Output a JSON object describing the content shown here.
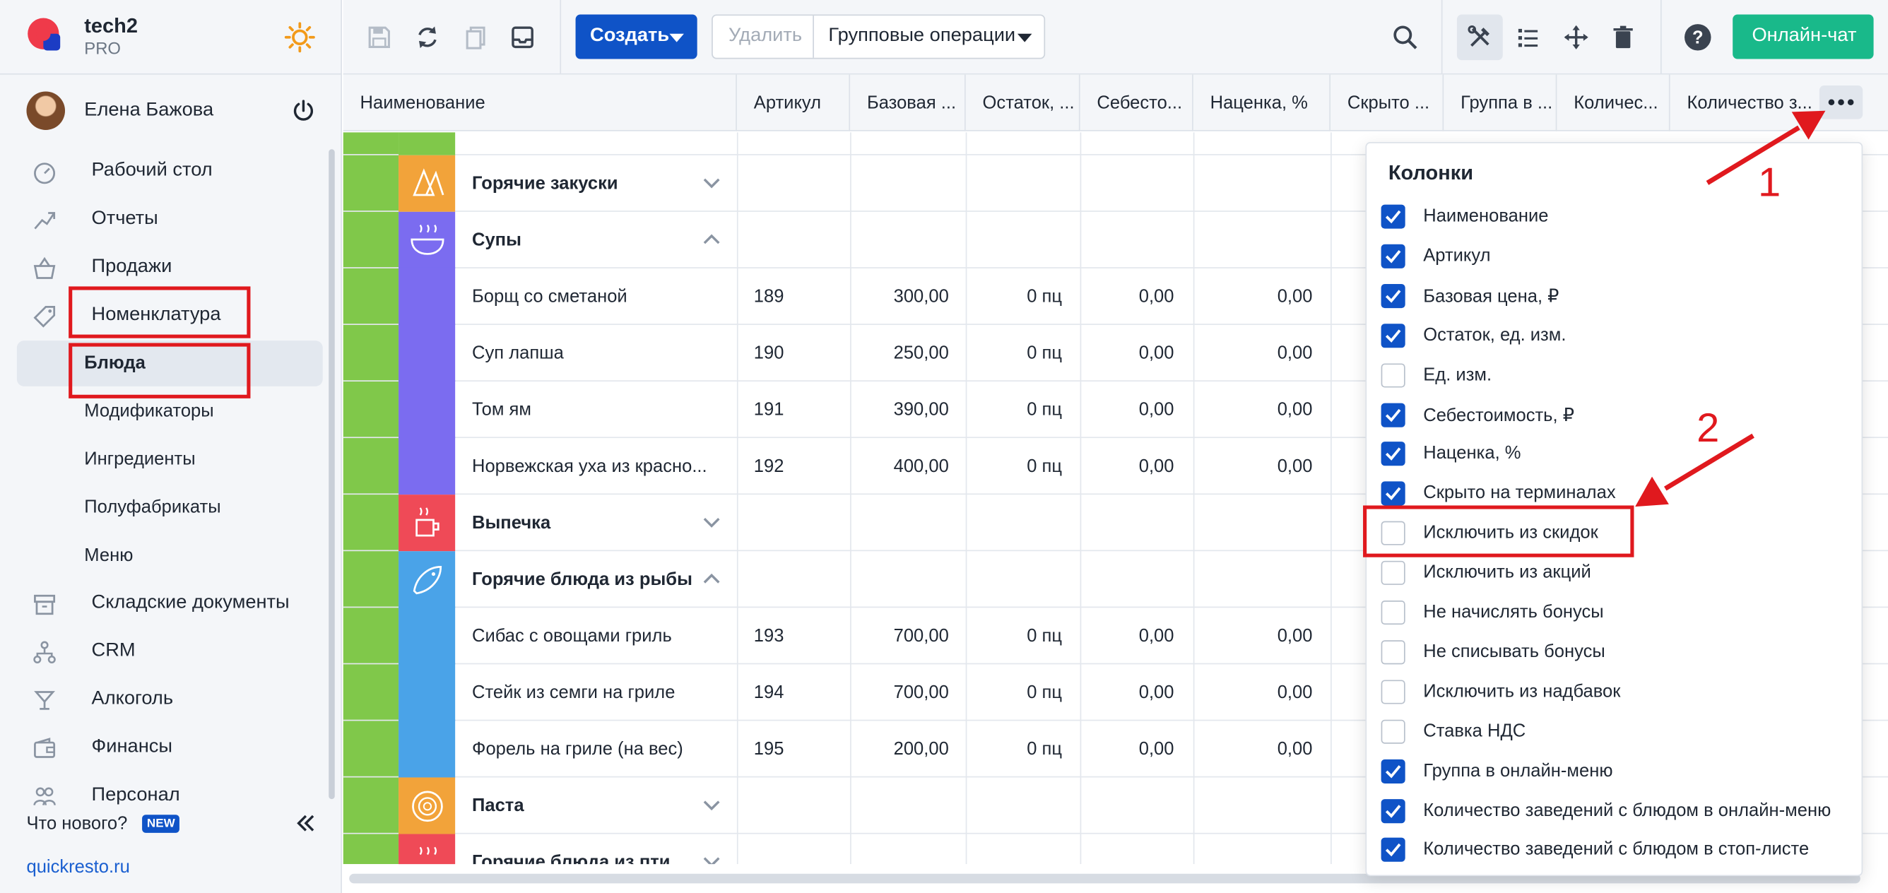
{
  "brand": {
    "name": "tech2",
    "plan": "PRO"
  },
  "user": {
    "name": "Елена Бажова"
  },
  "nav": [
    {
      "label": "Рабочий стол",
      "icon": "dashboard-icon"
    },
    {
      "label": "Отчеты",
      "icon": "chart-icon"
    },
    {
      "label": "Продажи",
      "icon": "basket-icon"
    },
    {
      "label": "Номенклатура",
      "icon": "tag-icon"
    },
    {
      "label": "Блюда",
      "sub": true
    },
    {
      "label": "Модификаторы",
      "sub": true
    },
    {
      "label": "Ингредиенты",
      "sub": true
    },
    {
      "label": "Полуфабрикаты",
      "sub": true
    },
    {
      "label": "Меню",
      "sub": true
    },
    {
      "label": "Складские документы",
      "icon": "warehouse-icon"
    },
    {
      "label": "CRM",
      "icon": "org-icon"
    },
    {
      "label": "Алкоголь",
      "icon": "glass-icon"
    },
    {
      "label": "Финансы",
      "icon": "wallet-icon"
    },
    {
      "label": "Персонал",
      "icon": "people-icon"
    }
  ],
  "sidebar_footer": {
    "whats_new": "Что нового?",
    "badge": "NEW",
    "site": "quickresto.ru"
  },
  "toolbar": {
    "create": "Создать",
    "delete": "Удалить",
    "group_ops": "Групповые операции",
    "chat": "Онлайн-чат"
  },
  "columns": [
    "Наименование",
    "Артикул",
    "Базовая ...",
    "Остаток, ...",
    "Себесто...",
    "Наценка, %",
    "Скрыто ...",
    "Группа в ...",
    "Количес...",
    "Количество з..."
  ],
  "rows": [
    {
      "type": "group",
      "name": "Горячие закуски",
      "color": "#f2a33a",
      "icon": "nachos-icon",
      "expanded": false
    },
    {
      "type": "group",
      "name": "Супы",
      "color": "#7b6cf0",
      "icon": "soup-icon",
      "expanded": true
    },
    {
      "type": "item",
      "name": "Борщ со сметаной",
      "sku": "189",
      "price": "300,00",
      "stock": "0 пц",
      "cost": "0,00",
      "markup": "0,00"
    },
    {
      "type": "item",
      "name": "Суп лапша",
      "sku": "190",
      "price": "250,00",
      "stock": "0 пц",
      "cost": "0,00",
      "markup": "0,00"
    },
    {
      "type": "item",
      "name": "Том ям",
      "sku": "191",
      "price": "390,00",
      "stock": "0 пц",
      "cost": "0,00",
      "markup": "0,00"
    },
    {
      "type": "item",
      "name": "Норвежская уха из красно...",
      "sku": "192",
      "price": "400,00",
      "stock": "0 пц",
      "cost": "0,00",
      "markup": "0,00"
    },
    {
      "type": "group",
      "name": "Выпечка",
      "color": "#ef4a57",
      "icon": "coffee-icon",
      "expanded": false
    },
    {
      "type": "group",
      "name": "Горячие блюда из рыбы",
      "color": "#4aa3e8",
      "icon": "fish-icon",
      "expanded": true
    },
    {
      "type": "item",
      "name": "Сибас с овощами гриль",
      "sku": "193",
      "price": "700,00",
      "stock": "0 пц",
      "cost": "0,00",
      "markup": "0,00"
    },
    {
      "type": "item",
      "name": "Стейк из семги на гриле",
      "sku": "194",
      "price": "700,00",
      "stock": "0 пц",
      "cost": "0,00",
      "markup": "0,00"
    },
    {
      "type": "item",
      "name": "Форель на гриле (на вес)",
      "sku": "195",
      "price": "200,00",
      "stock": "0 пц",
      "cost": "0,00",
      "markup": "0,00"
    },
    {
      "type": "group",
      "name": "Паста",
      "color": "#f2a33a",
      "icon": "pasta-icon",
      "expanded": false
    },
    {
      "type": "group",
      "name": "Горячие блюда из пти",
      "color": "#ef4a57",
      "icon": "poultry-icon",
      "expanded": false
    }
  ],
  "columns_panel": {
    "title": "Колонки",
    "options": [
      {
        "label": "Наименование",
        "checked": true
      },
      {
        "label": "Артикул",
        "checked": true
      },
      {
        "label": "Базовая цена, ₽",
        "checked": true
      },
      {
        "label": "Остаток, ед. изм.",
        "checked": true
      },
      {
        "label": "Ед. изм.",
        "checked": false
      },
      {
        "label": "Себестоимость, ₽",
        "checked": true
      },
      {
        "label": "Наценка, %",
        "checked": true
      },
      {
        "label": "Скрыто на терминалах",
        "checked": true
      },
      {
        "label": "Исключить из скидок",
        "checked": false
      },
      {
        "label": "Исключить из акций",
        "checked": false
      },
      {
        "label": "Не начислять бонусы",
        "checked": false
      },
      {
        "label": "Не списывать бонусы",
        "checked": false
      },
      {
        "label": "Исключить из надбавок",
        "checked": false
      },
      {
        "label": "Ставка НДС",
        "checked": false
      },
      {
        "label": "Группа в онлайн-меню",
        "checked": true
      },
      {
        "label": "Количество заведений с блюдом в онлайн-меню",
        "checked": true
      },
      {
        "label": "Количество заведений с блюдом в стоп-листе",
        "checked": true
      }
    ]
  },
  "annotations": {
    "step1": "1",
    "step2": "2"
  },
  "colors": {
    "accent": "#0f53c7",
    "chat": "#19b98a",
    "annotation": "#e0191e",
    "group_strip": "#80c84a"
  }
}
